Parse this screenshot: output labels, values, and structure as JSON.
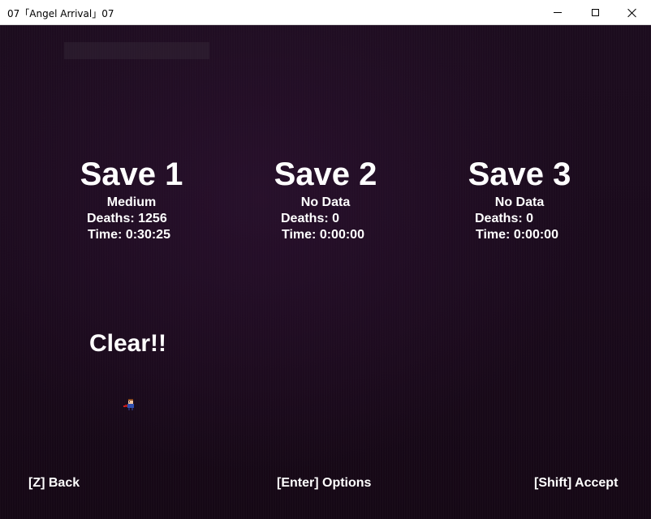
{
  "window": {
    "title": "07「Angel Arrival」07"
  },
  "slots": [
    {
      "title": "Save 1",
      "difficulty": "Medium",
      "deaths": "Deaths: 1256",
      "time": "Time: 0:30:25"
    },
    {
      "title": "Save 2",
      "difficulty": "No Data",
      "deaths": "Deaths: 0",
      "time": "Time: 0:00:00"
    },
    {
      "title": "Save 3",
      "difficulty": "No Data",
      "deaths": "Deaths: 0",
      "time": "Time: 0:00:00"
    }
  ],
  "clear_label": "Clear!!",
  "controls": {
    "back": "[Z] Back",
    "options": "[Enter] Options",
    "accept": "[Shift] Accept"
  },
  "colors": {
    "background": "#1a0a1c",
    "text": "#ffffff"
  }
}
